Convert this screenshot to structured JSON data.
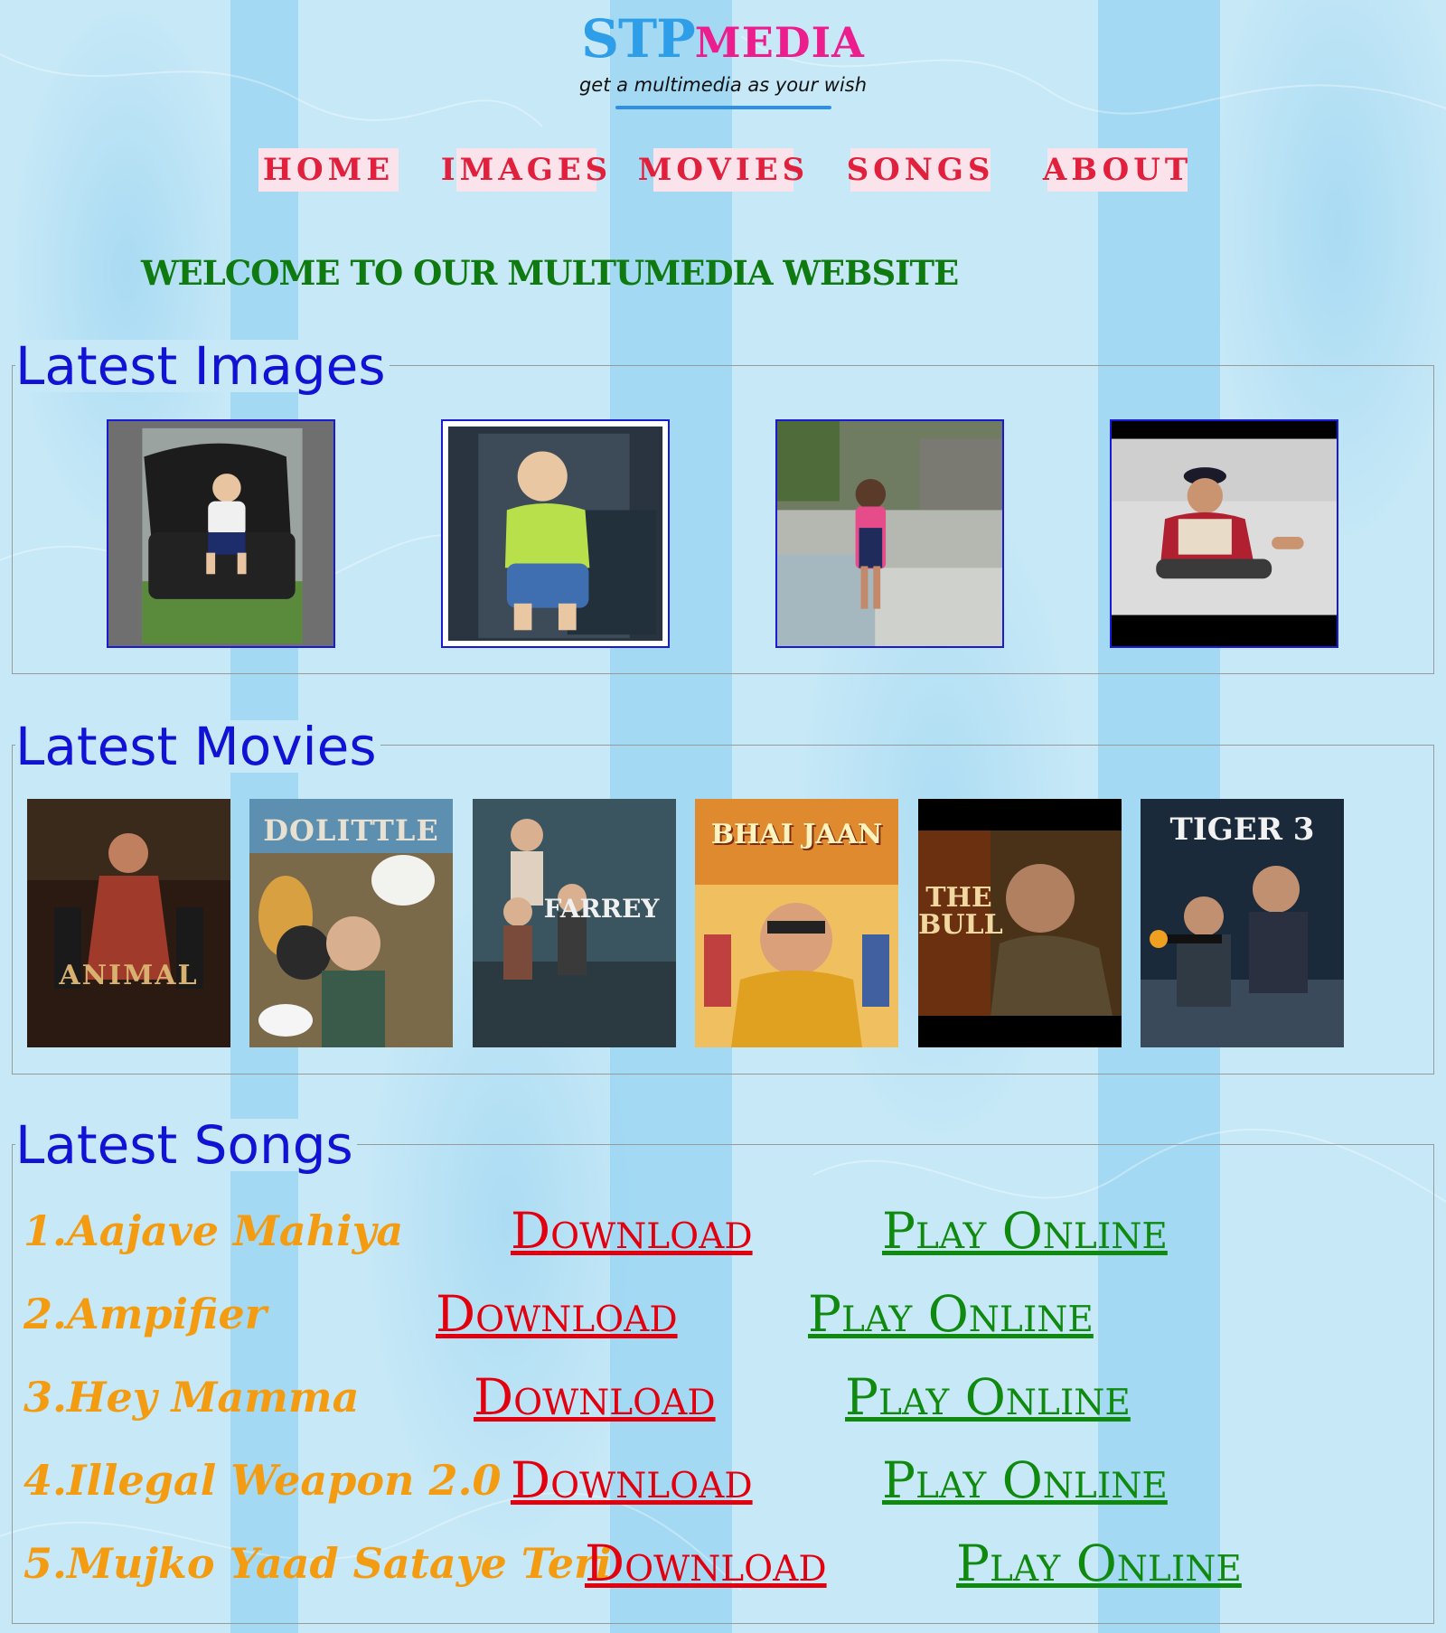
{
  "header": {
    "logo_part1": "STP",
    "logo_part2": "MEDIA",
    "tagline": "get a multimedia as your wish"
  },
  "nav": {
    "items": [
      {
        "label": "HOME"
      },
      {
        "label": "IMAGES"
      },
      {
        "label": "MOVIES"
      },
      {
        "label": "SONGS"
      },
      {
        "label": "ABOUT"
      }
    ]
  },
  "welcome": "WELCOME TO OUR MULTUMEDIA WEBSITE",
  "images_section": {
    "title": "Latest Images",
    "items": [
      {
        "icon": "child-on-chair-photo"
      },
      {
        "icon": "baby-photo"
      },
      {
        "icon": "child-standing-photo"
      },
      {
        "icon": "child-sitting-photo"
      }
    ]
  },
  "movies_section": {
    "title": "Latest Movies",
    "items": [
      {
        "poster_text": "ANIMAL"
      },
      {
        "poster_text": "DOLITTLE"
      },
      {
        "poster_text": "FARREY"
      },
      {
        "poster_text": "BHAI JAAN"
      },
      {
        "poster_text": "THE BULL"
      },
      {
        "poster_text": "TIGER 3"
      }
    ]
  },
  "songs_section": {
    "title": "Latest Songs",
    "download_label": "Download",
    "play_label": "Play Online",
    "items": [
      {
        "name": "1.Aajave Mahiya"
      },
      {
        "name": "2.Ampifier"
      },
      {
        "name": "3.Hey Mamma"
      },
      {
        "name": "4.Illegal Weapon 2.0"
      },
      {
        "name": "5.Mujko Yaad Sataye Teri"
      }
    ]
  },
  "colors": {
    "background": "#c6e8f7",
    "logo_blue": "#2f9ee8",
    "logo_pink": "#ec1e8e",
    "nav_text": "#e0203c",
    "welcome_green": "#0f7a0f",
    "section_title_blue": "#1212d4",
    "song_orange": "#f39c12",
    "download_red": "#e2000f",
    "play_green": "#0f8a0f"
  }
}
